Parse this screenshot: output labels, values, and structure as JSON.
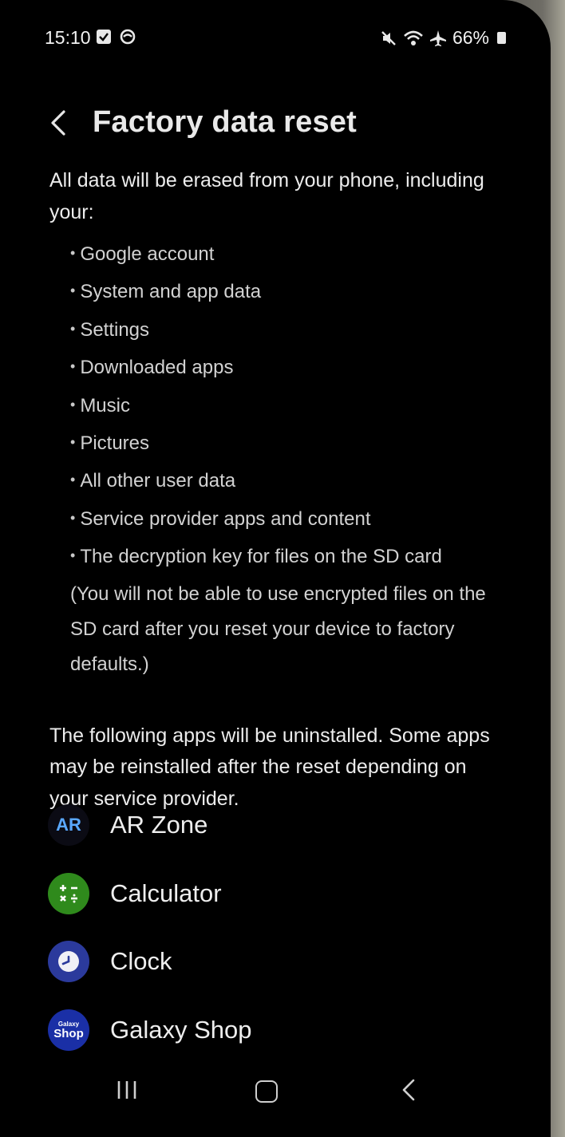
{
  "status_bar": {
    "time": "15:10",
    "battery": "66%",
    "left_icons": [
      "notification-check-icon",
      "messenger-icon"
    ],
    "right_icons": [
      "mute-icon",
      "wifi-icon",
      "airplane-icon",
      "battery-icon"
    ]
  },
  "header": {
    "title": "Factory data reset",
    "back_icon": "chevron-left-icon"
  },
  "content": {
    "intro": "All data will be erased from your phone, including your:",
    "bullets": [
      "Google account",
      "System and app data",
      "Settings",
      "Downloaded apps",
      "Music",
      "Pictures",
      "All other user data",
      "Service provider apps and content",
      "The decryption key for files on the SD card"
    ],
    "bullet_note": "(You will not be able to use encrypted files on the SD card after you reset your device to factory defaults.)",
    "apps_intro": "The following apps will be uninstalled. Some apps may be reinstalled after the reset depending on your service provider."
  },
  "apps": [
    {
      "name": "AR Zone",
      "icon": "ar-zone-icon",
      "icon_text": "AR"
    },
    {
      "name": "Calculator",
      "icon": "calculator-icon"
    },
    {
      "name": "Clock",
      "icon": "clock-icon"
    },
    {
      "name": "Galaxy Shop",
      "icon": "galaxy-shop-icon",
      "icon_text_small": "Galaxy",
      "icon_text_big": "Shop"
    }
  ],
  "nav_bar": {
    "icons": [
      "recents-icon",
      "home-icon",
      "back-icon"
    ]
  }
}
